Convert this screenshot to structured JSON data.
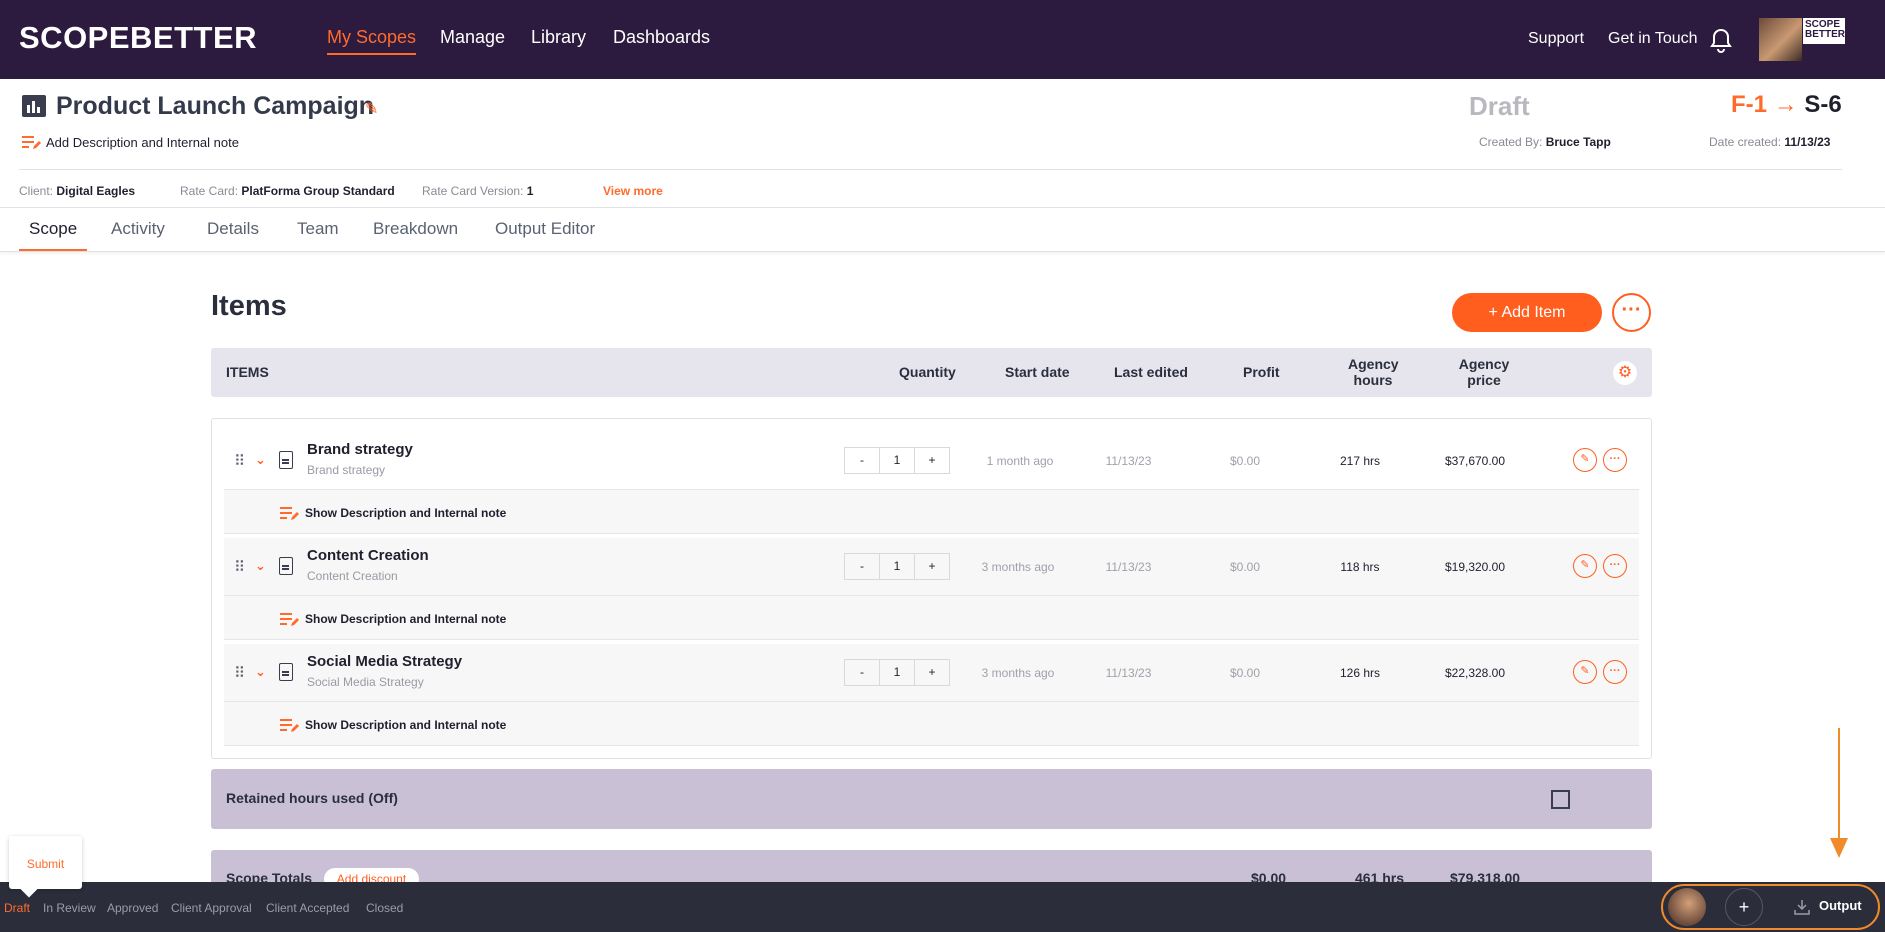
{
  "nav": {
    "logo": "SCOPEBETTER",
    "links": [
      "My Scopes",
      "Manage",
      "Library",
      "Dashboards"
    ],
    "right_links": [
      "Support",
      "Get in Touch"
    ],
    "brand_badge": "SCOPE BETTER"
  },
  "header": {
    "title": "Product Launch Campaign",
    "desc_link": "Add Description and Internal note",
    "status": "Draft",
    "version_from": "F-1",
    "version_arrow": "→",
    "version_to": "S-6",
    "created_by_label": "Created By:",
    "created_by": "Bruce Tapp",
    "date_created_label": "Date created:",
    "date_created": "11/13/23",
    "client_label": "Client:",
    "client": "Digital Eagles",
    "rate_card_label": "Rate Card:",
    "rate_card": "PlatForma Group Standard",
    "rate_card_version_label": "Rate Card Version:",
    "rate_card_version": "1",
    "view_more": "View more"
  },
  "tabs": [
    "Scope",
    "Activity",
    "Details",
    "Team",
    "Breakdown",
    "Output Editor"
  ],
  "items_section": {
    "title": "Items",
    "add_item": "+ Add Item",
    "more": "···",
    "columns": {
      "items": "ITEMS",
      "quantity": "Quantity",
      "start_date": "Start date",
      "last_edited": "Last edited",
      "profit": "Profit",
      "agency_hours_1": "Agency",
      "agency_hours_2": "hours",
      "agency_price_1": "Agency",
      "agency_price_2": "price"
    },
    "rows": [
      {
        "name": "Brand strategy",
        "sub": "Brand strategy",
        "qty": "1",
        "start": "1 month ago",
        "edited": "11/13/23",
        "profit": "$0.00",
        "hours": "217 hrs",
        "price": "$37,670.00"
      },
      {
        "name": "Content Creation",
        "sub": "Content Creation",
        "qty": "1",
        "start": "3 months ago",
        "edited": "11/13/23",
        "profit": "$0.00",
        "hours": "118 hrs",
        "price": "$19,320.00"
      },
      {
        "name": "Social Media Strategy",
        "sub": "Social Media Strategy",
        "qty": "1",
        "start": "3 months ago",
        "edited": "11/13/23",
        "profit": "$0.00",
        "hours": "126 hrs",
        "price": "$22,328.00"
      }
    ],
    "show_desc": "Show Description and Internal note",
    "minus": "-",
    "plus": "+",
    "retained_label": "Retained hours used (Off)",
    "totals_label": "Scope Totals",
    "add_discount": "Add discount",
    "total_profit": "$0.00",
    "total_hours": "461 hrs",
    "total_price": "$79,318.00"
  },
  "bottom": {
    "submit": "Submit",
    "steps": [
      "Draft",
      "In Review",
      "Approved",
      "Client Approval",
      "Client Accepted",
      "Closed"
    ],
    "output": "Output"
  },
  "colors": {
    "accent": "#ff5e1f",
    "nav_bg": "#2c1a3f",
    "bottom_bg": "#2b2d3a"
  }
}
